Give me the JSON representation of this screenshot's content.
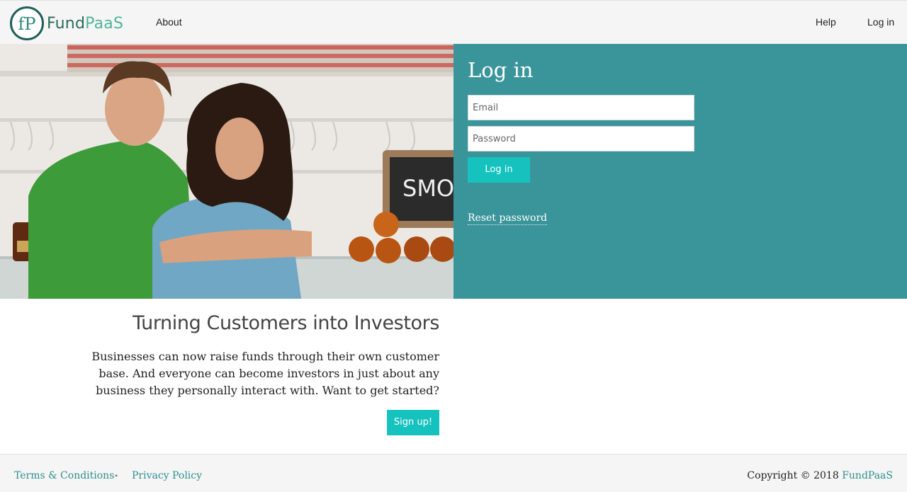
{
  "header": {
    "logo_text_fund": "Fund",
    "logo_text_paas": "PaaS",
    "logo_mark_letters": "fP",
    "nav": {
      "about": "About",
      "help": "Help",
      "login": "Log in"
    }
  },
  "login": {
    "title": "Log in",
    "email_placeholder": "Email",
    "password_placeholder": "Password",
    "submit_label": "Log in",
    "reset_label": "Reset password"
  },
  "hero_image": {
    "sign_text": "SMO"
  },
  "marketing": {
    "tagline": "Turning Customers into Investors",
    "pitch": "Businesses can now raise funds through their own customer base. And everyone can become investors in just about any business they personally interact with. Want to get started?",
    "signup_label": "Sign up!"
  },
  "footer": {
    "terms": "Terms & Conditions",
    "separator": "•",
    "privacy": "Privacy Policy",
    "copyright_prefix": "Copyright © 2018",
    "copyright_brand": "FundPaaS"
  },
  "colors": {
    "panel": "#3a959b",
    "button": "#16c2be",
    "link": "#2e8f8f"
  }
}
